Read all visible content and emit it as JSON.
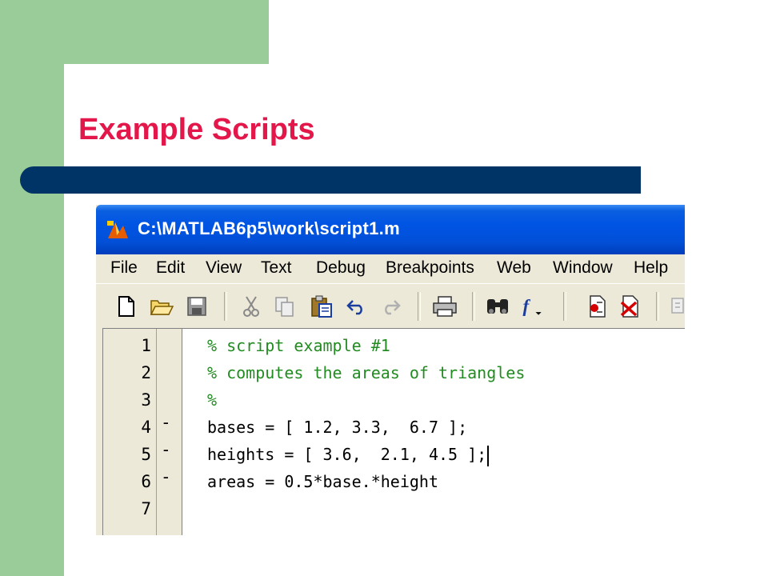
{
  "slide": {
    "title": "Example Scripts",
    "colors": {
      "title": "#e3174a",
      "rule": "#003366",
      "sidebar": "#99cc99"
    }
  },
  "window": {
    "title": "C:\\MATLAB6p5\\work\\script1.m",
    "app_icon": "matlab-logo-icon"
  },
  "menu": [
    "File",
    "Edit",
    "View",
    "Text",
    "Debug",
    "Breakpoints",
    "Web",
    "Window",
    "Help"
  ],
  "toolbar": {
    "buttons": [
      "new-file-icon",
      "open-folder-icon",
      "save-icon",
      "cut-icon",
      "copy-icon",
      "paste-icon",
      "undo-icon",
      "redo-icon",
      "print-icon",
      "find-binoculars-icon",
      "function-icon",
      "set-breakpoint-icon",
      "clear-breakpoints-icon",
      "step-icon"
    ]
  },
  "editor": {
    "lines": [
      {
        "num": "1",
        "marker": "",
        "text": "% script example #1",
        "type": "comment"
      },
      {
        "num": "2",
        "marker": "",
        "text": "% computes the areas of triangles",
        "type": "comment"
      },
      {
        "num": "3",
        "marker": "",
        "text": "%",
        "type": "comment"
      },
      {
        "num": "4",
        "marker": "-",
        "text": "bases = [ 1.2, 3.3,  6.7 ];",
        "type": "code"
      },
      {
        "num": "5",
        "marker": "-",
        "text": "heights = [ 3.6,  2.1, 4.5 ];",
        "type": "code"
      },
      {
        "num": "6",
        "marker": "-",
        "text": "areas = 0.5*base.*height",
        "type": "code"
      },
      {
        "num": "7",
        "marker": "",
        "text": "",
        "type": "code"
      }
    ],
    "colors": {
      "comment": "#228b22",
      "code": "#000000"
    }
  }
}
